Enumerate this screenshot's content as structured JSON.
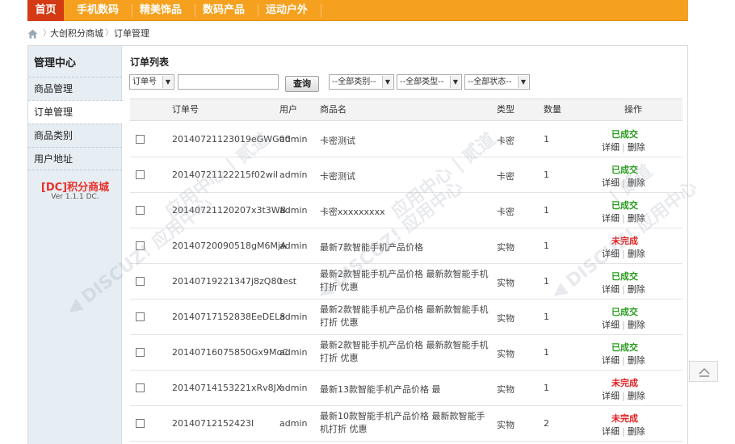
{
  "nav": {
    "items": [
      {
        "label": "首页",
        "active": true
      },
      {
        "label": "手机数码",
        "active": false
      },
      {
        "label": "精美饰品",
        "active": false
      },
      {
        "label": "数码产品",
        "active": false
      },
      {
        "label": "运动户外",
        "active": false
      }
    ]
  },
  "breadcrumb": {
    "home_icon": "home-icon",
    "items": [
      "大创积分商城",
      "订单管理"
    ]
  },
  "sidebar": {
    "title": "管理中心",
    "items": [
      {
        "label": "商品管理"
      },
      {
        "label": "订单管理"
      },
      {
        "label": "商品类别"
      },
      {
        "label": "用户地址"
      }
    ],
    "brand": "[DC]积分商城",
    "version": "Ver 1.1.1 DC."
  },
  "content": {
    "title": "订单列表",
    "filter": {
      "field_select": "订单号",
      "search_value": "",
      "search_button": "查询",
      "category_select": "--全部类别--",
      "type_select": "--全部类型--",
      "status_select": "--全部状态--"
    },
    "table": {
      "headers": [
        "订单号",
        "用户",
        "商品名",
        "类型",
        "数量",
        "操作"
      ],
      "rows": [
        {
          "order_no": "20140721123019eGWG00",
          "user": "admin",
          "product": "卡密测试",
          "type": "卡密",
          "qty": "1",
          "status": "已成交",
          "status_color": "#2a9d1f"
        },
        {
          "order_no": "20140721122215f02wiI",
          "user": "admin",
          "product": "卡密测试",
          "type": "卡密",
          "qty": "1",
          "status": "已成交",
          "status_color": "#2a9d1f"
        },
        {
          "order_no": "20140721120207x3t3WB",
          "user": "admin",
          "product": "卡密xxxxxxxxx",
          "type": "卡密",
          "qty": "1",
          "status": "已成交",
          "status_color": "#2a9d1f"
        },
        {
          "order_no": "20140720090518gM6MjA",
          "user": "admin",
          "product": "最新7款智能手机产品价格",
          "type": "实物",
          "qty": "1",
          "status": "未完成",
          "status_color": "#e02020"
        },
        {
          "order_no": "20140719221347j8zQ80",
          "user": "test",
          "product": "最新2款智能手机产品价格 最新款智能手机打折 优惠",
          "type": "实物",
          "qty": "1",
          "status": "已成交",
          "status_color": "#2a9d1f"
        },
        {
          "order_no": "20140717152838EeDEL8",
          "user": "admin",
          "product": "最新2款智能手机产品价格 最新款智能手机打折 优惠",
          "type": "实物",
          "qty": "1",
          "status": "已成交",
          "status_color": "#2a9d1f"
        },
        {
          "order_no": "20140716075850Gx9MoC",
          "user": "admin",
          "product": "最新2款智能手机产品价格 最新款智能手机打折 优惠",
          "type": "实物",
          "qty": "1",
          "status": "已成交",
          "status_color": "#2a9d1f"
        },
        {
          "order_no": "20140714153221xRv8JX",
          "user": "admin",
          "product": "最新13款智能手机产品价格 最",
          "type": "实物",
          "qty": "1",
          "status": "未完成",
          "status_color": "#e02020"
        },
        {
          "order_no": "20140712152423I",
          "user": "admin",
          "product": "最新10款智能手机产品价格 最新款智能手机打折 优惠",
          "type": "实物",
          "qty": "2",
          "status": "未完成",
          "status_color": "#e02020"
        }
      ],
      "detail_label": "详细",
      "delete_label": "删除"
    }
  },
  "colors": {
    "nav_bg": "#f5a11f",
    "nav_active": "#d43a14",
    "sidebar_bg": "#e6edf3",
    "done": "#2a9d1f",
    "pending": "#e02020"
  }
}
